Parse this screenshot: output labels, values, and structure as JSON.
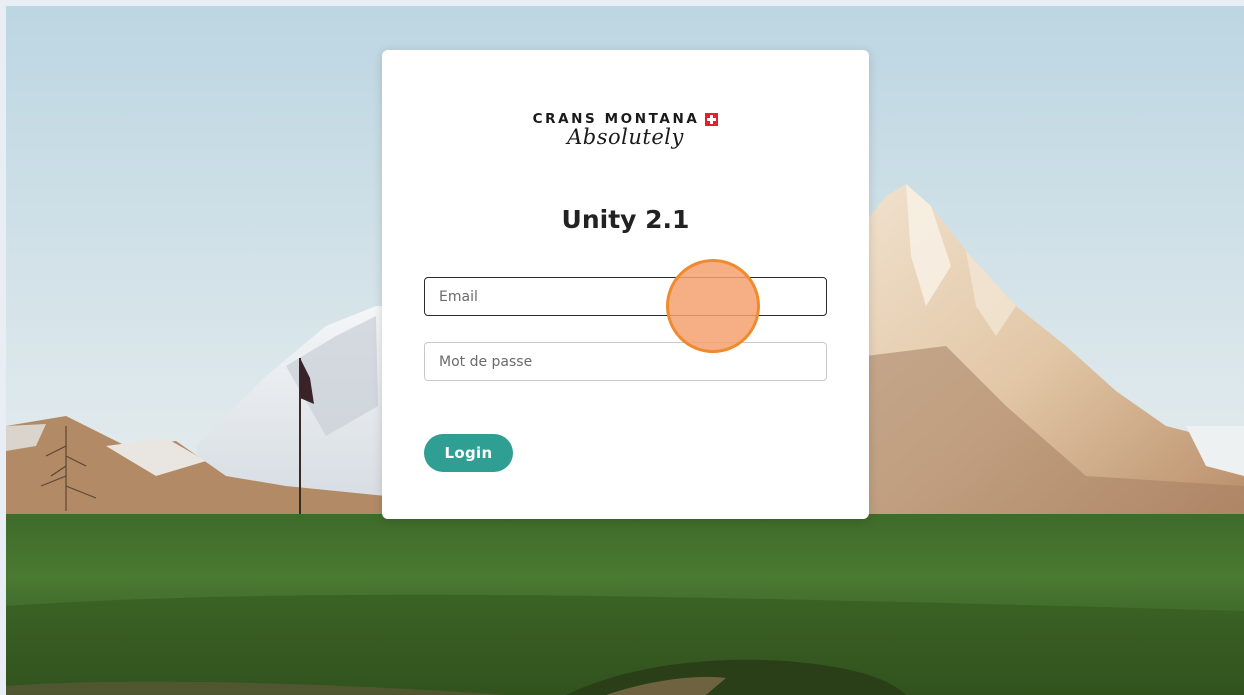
{
  "logo": {
    "line1": "CRANS MONTANA",
    "line2": "Absolutely",
    "flag_icon": "swiss-flag-icon"
  },
  "login": {
    "title": "Unity 2.1",
    "email_placeholder": "Email",
    "email_value": "",
    "password_placeholder": "Mot de passe",
    "password_value": "",
    "button_label": "Login"
  },
  "colors": {
    "accent": "#2f9e93",
    "click_marker": "#f08a2c",
    "swiss_red": "#e5202e"
  }
}
